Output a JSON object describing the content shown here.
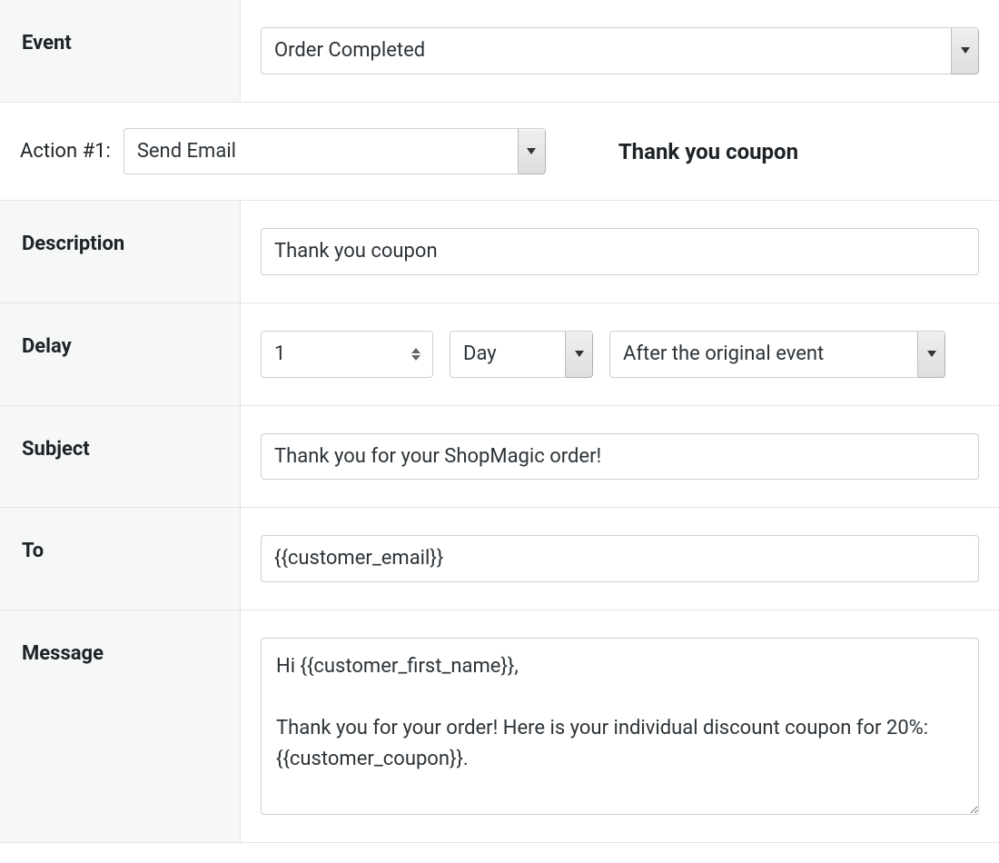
{
  "event": {
    "label": "Event",
    "value": "Order Completed"
  },
  "action": {
    "label": "Action #1:",
    "type": "Send Email",
    "title": "Thank you coupon"
  },
  "description": {
    "label": "Description",
    "value": "Thank you coupon"
  },
  "delay": {
    "label": "Delay",
    "amount": "1",
    "unit": "Day",
    "relative": "After the original event"
  },
  "subject": {
    "label": "Subject",
    "value": "Thank you for your ShopMagic order!"
  },
  "to": {
    "label": "To",
    "value": "{{customer_email}}"
  },
  "message": {
    "label": "Message",
    "value": "Hi {{customer_first_name}},\n\nThank you for your order! Here is your individual discount coupon for 20%: {{customer_coupon}}."
  }
}
